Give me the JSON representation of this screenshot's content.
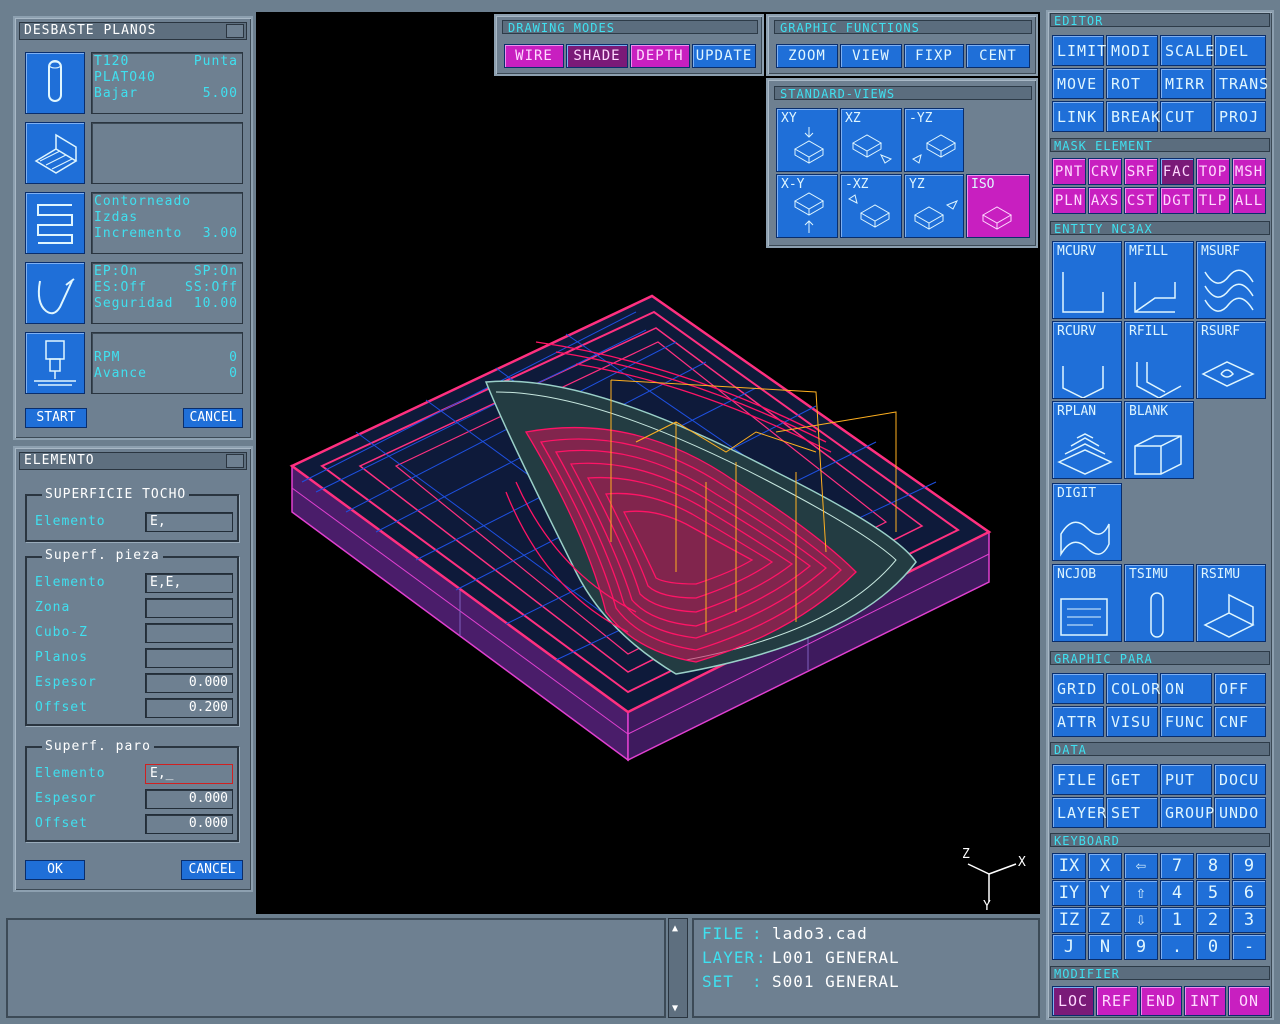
{
  "desbaste": {
    "title": "DESBASTE PLANOS",
    "tool": {
      "name": "T120",
      "kind": "Punta",
      "holder": "PLATO40",
      "mode": "Bajar",
      "mode_val": "5.00"
    },
    "strategy": {
      "l1": "Contorneado",
      "l2": "Izdas",
      "l3": "Incremento",
      "l3_val": "3.00"
    },
    "approach": {
      "a": "EP:On",
      "b": "SP:On",
      "c": "ES:Off",
      "d": "SS:Off",
      "e": "Seguridad",
      "e_val": "10.00"
    },
    "machine": {
      "rpm": "RPM",
      "rpm_val": "0",
      "feed": "Avance",
      "feed_val": "0"
    },
    "start": "START",
    "cancel": "CANCEL"
  },
  "elemento": {
    "title": "ELEMENTO",
    "g1": {
      "label": "SUPERFICIE TOCHO",
      "elemento": "Elemento",
      "elemento_val": "E,"
    },
    "g2": {
      "label": "Superf. pieza",
      "elemento": "Elemento",
      "elemento_val": "E,E,",
      "zona": "Zona",
      "cubo": "Cubo-Z",
      "planos": "Planos",
      "espesor": "Espesor",
      "espesor_val": "0.000",
      "offset": "Offset",
      "offset_val": "0.200"
    },
    "g3": {
      "label": "Superf. paro",
      "elemento": "Elemento",
      "elemento_val": "E,_",
      "espesor": "Espesor",
      "espesor_val": "0.000",
      "offset": "Offset",
      "offset_val": "0.000"
    },
    "ok": "OK",
    "cancel": "CANCEL"
  },
  "drawing_modes": {
    "title": "DRAWING MODES",
    "wire": "WIRE",
    "shade": "SHADE",
    "depth": "DEPTH",
    "update": "UPDATE"
  },
  "graphic_functions": {
    "title": "GRAPHIC FUNCTIONS",
    "zoom": "ZOOM",
    "view": "VIEW",
    "fixp": "FIXP",
    "cent": "CENT"
  },
  "standard_views": {
    "title": "STANDARD-VIEWS",
    "v": [
      "XY",
      "XZ",
      "-YZ",
      "X-Y",
      "-XZ",
      "YZ",
      "ISO"
    ]
  },
  "editor": {
    "title": "EDITOR",
    "b": [
      "LIMIT",
      "MODI",
      "SCALE",
      "DEL",
      "MOVE",
      "ROT",
      "MIRR",
      "TRANS",
      "LINK",
      "BREAK",
      "CUT",
      "PROJ"
    ]
  },
  "mask": {
    "title": "MASK  ELEMENT",
    "b": [
      "PNT",
      "CRV",
      "SRF",
      "FAC",
      "TOP",
      "MSH",
      "PLN",
      "AXS",
      "CST",
      "DGT",
      "TLP",
      "ALL"
    ]
  },
  "entity": {
    "title": "ENTITY  NC3AX",
    "t": [
      "MCURV",
      "MFILL",
      "MSURF",
      "RCURV",
      "RFILL",
      "RSURF",
      "RPLAN",
      "BLANK",
      "DIGIT",
      "NCJOB",
      "TSIMU",
      "RSIMU"
    ]
  },
  "graphic_para": {
    "title": "GRAPHIC  PARA",
    "b": [
      "GRID",
      "COLOR",
      "ON",
      "OFF",
      "ATTR",
      "VISU",
      "FUNC",
      "CNF"
    ]
  },
  "data": {
    "title": "DATA",
    "b": [
      "FILE",
      "GET",
      "PUT",
      "DOCU",
      "LAYER",
      "SET",
      "GROUP",
      "UNDO"
    ]
  },
  "keyboard": {
    "title": "KEYBOARD",
    "k": [
      "IX",
      "X",
      "⇦",
      "7",
      "8",
      "9",
      "IY",
      "Y",
      "⇧",
      "4",
      "5",
      "6",
      "IZ",
      "Z",
      "⇩",
      "1",
      "2",
      "3",
      "J",
      "N",
      "9",
      ".",
      "0",
      "-"
    ]
  },
  "modifier": {
    "title": "MODIFIER",
    "b": [
      "LOC",
      "REF",
      "END",
      "INT",
      "ON"
    ]
  },
  "status": {
    "file_k": "FILE",
    "file_v": "lado3.cad",
    "layer_k": "LAYER",
    "layer_v": "L001 GENERAL",
    "set_k": "SET",
    "set_v": "S001 GENERAL"
  },
  "axes": {
    "x": "X",
    "y": "Y",
    "z": "Z"
  },
  "colors": {
    "accent": "#3fe0f0",
    "button": "#1f6fd8",
    "active": "#c81fc0"
  }
}
